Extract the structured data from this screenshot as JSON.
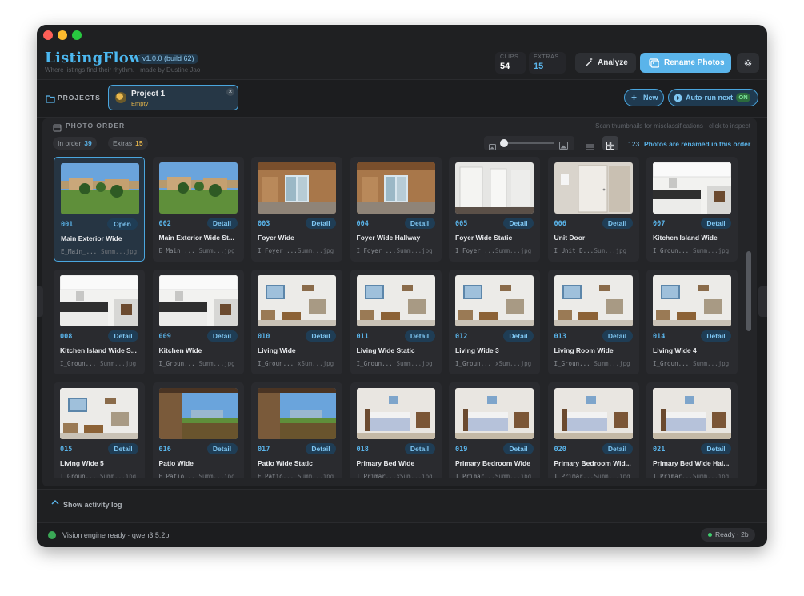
{
  "header": {
    "app_name": "ListingFlow",
    "version": "v1.0.0 (build 62)",
    "tagline": "Where listings find their rhythm. · made by Dustine Jao",
    "stats": [
      {
        "label": "CLIPS",
        "value": "54",
        "color": "#ffffff"
      },
      {
        "label": "EXTRAS",
        "value": "15",
        "color": "#5ab4ea"
      }
    ],
    "analyze_label": "Analyze",
    "rename_label": "Rename Photos"
  },
  "projects": {
    "label": "PROJECTS",
    "active": {
      "name": "Project 1",
      "status": "Empty"
    },
    "new_label": "New",
    "autorun_label": "Auto-run next",
    "autorun_state": "ON"
  },
  "photo_order": {
    "label": "PHOTO ORDER",
    "hint": "Scan thumbnails for misclassifications · click to inspect",
    "in_order_label": "In order",
    "in_order_count": "39",
    "extras_label": "Extras",
    "extras_count": "15",
    "renamed_count": "123",
    "renamed_text": "Photos are renamed in this order",
    "zoom_level": 0.1
  },
  "photos": [
    {
      "num": "001",
      "action": "Open",
      "title": "Main Exterior Wide",
      "file": "E_Main_...",
      "suffix": "Summ...jpg",
      "scene": "exterior",
      "selected": true
    },
    {
      "num": "002",
      "action": "Detail",
      "title": "Main Exterior Wide St...",
      "file": "E_Main_...",
      "suffix": "Summ...jpg",
      "scene": "exterior"
    },
    {
      "num": "003",
      "action": "Detail",
      "title": "Foyer Wide",
      "file": "I_Foyer_...",
      "suffix": "Summ...jpg",
      "scene": "foyer"
    },
    {
      "num": "004",
      "action": "Detail",
      "title": "Foyer Wide Hallway",
      "file": "I_Foyer_...",
      "suffix": "Summ...jpg",
      "scene": "foyer"
    },
    {
      "num": "005",
      "action": "Detail",
      "title": "Foyer Wide Static",
      "file": "I_Foyer_...",
      "suffix": "Summ...jpg",
      "scene": "closet"
    },
    {
      "num": "006",
      "action": "Detail",
      "title": "Unit Door",
      "file": "I_Unit_D...",
      "suffix": "Sum...jpg",
      "scene": "door"
    },
    {
      "num": "007",
      "action": "Detail",
      "title": "Kitchen Island Wide",
      "file": "I_Groun...",
      "suffix": "Summ...jpg",
      "scene": "kitchen"
    },
    {
      "num": "008",
      "action": "Detail",
      "title": "Kitchen Island Wide S...",
      "file": "I_Groun...",
      "suffix": "Summ...jpg",
      "scene": "kitchen"
    },
    {
      "num": "009",
      "action": "Detail",
      "title": "Kitchen Wide",
      "file": "I_Groun...",
      "suffix": "Summ...jpg",
      "scene": "kitchen"
    },
    {
      "num": "010",
      "action": "Detail",
      "title": "Living Wide",
      "file": "I_Groun...",
      "suffix": "xSum...jpg",
      "scene": "living"
    },
    {
      "num": "011",
      "action": "Detail",
      "title": "Living Wide Static",
      "file": "I_Groun...",
      "suffix": "Summ...jpg",
      "scene": "living"
    },
    {
      "num": "012",
      "action": "Detail",
      "title": "Living Wide 3",
      "file": "I_Groun...",
      "suffix": "xSum...jpg",
      "scene": "living"
    },
    {
      "num": "013",
      "action": "Detail",
      "title": "Living Room Wide",
      "file": "I_Groun...",
      "suffix": "Summ...jpg",
      "scene": "living"
    },
    {
      "num": "014",
      "action": "Detail",
      "title": "Living Wide 4",
      "file": "I_Groun...",
      "suffix": "Summ...jpg",
      "scene": "living"
    },
    {
      "num": "015",
      "action": "Detail",
      "title": "Living Wide 5",
      "file": "I_Groun...",
      "suffix": "Summ...jpg",
      "scene": "living"
    },
    {
      "num": "016",
      "action": "Detail",
      "title": "Patio Wide",
      "file": "E_Patio...",
      "suffix": "Summ...jpg",
      "scene": "patio"
    },
    {
      "num": "017",
      "action": "Detail",
      "title": "Patio Wide Static",
      "file": "E_Patio...",
      "suffix": "Summ...jpg",
      "scene": "patio"
    },
    {
      "num": "018",
      "action": "Detail",
      "title": "Primary Bed Wide",
      "file": "I_Primar...",
      "suffix": "xSum...jpg",
      "scene": "bedroom"
    },
    {
      "num": "019",
      "action": "Detail",
      "title": "Primary Bedroom Wide",
      "file": "I_Primar...",
      "suffix": "Summ...jpg",
      "scene": "bedroom"
    },
    {
      "num": "020",
      "action": "Detail",
      "title": "Primary Bedroom Wid...",
      "file": "I_Primar...",
      "suffix": "Summ...jpg",
      "scene": "bedroom"
    },
    {
      "num": "021",
      "action": "Detail",
      "title": "Primary Bed Wide Hal...",
      "file": "I_Primar...",
      "suffix": "Summ...jpg",
      "scene": "bedroom"
    }
  ],
  "activity": {
    "label": "Show activity log"
  },
  "status": {
    "engine": "Vision engine ready · qwen3.5:2b",
    "pill": "Ready · 2b"
  },
  "colors": {
    "accent": "#5ab4ea",
    "background": "#1c1d1f",
    "card": "#2a2b2f",
    "ready": "#3fcf6e"
  },
  "icons": [
    "settings-gear-icon",
    "wand-icon",
    "photos-icon",
    "folder-icon",
    "plus-icon",
    "play-icon",
    "grid-view-icon",
    "list-view-icon",
    "image-small-icon",
    "image-large-icon",
    "chevron-up-icon",
    "check-shield-icon",
    "close-icon"
  ]
}
